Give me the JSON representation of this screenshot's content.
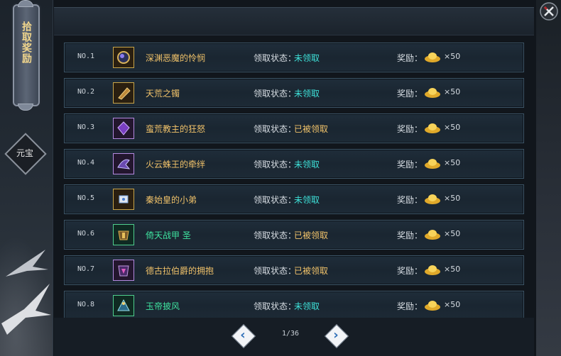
{
  "sidebar": {
    "scroll_tab_label": "拾取奖励",
    "diamond_label": "元宝"
  },
  "rows": [
    {
      "no": "NO.1",
      "icon": "dark-mask-icon",
      "name": "深渊恶魔的怜悯",
      "status_label": "领取状态：",
      "status": "未领取",
      "reward_label": "奖励：",
      "reward_icon": "gold-ingot-icon",
      "amount": "×50"
    },
    {
      "no": "NO.2",
      "icon": "bracer-icon",
      "name": "天荒之镯",
      "status_label": "领取状态：",
      "status": "未领取",
      "reward_label": "奖励：",
      "reward_icon": "gold-ingot-icon",
      "amount": "×50"
    },
    {
      "no": "NO.3",
      "icon": "purple-gem-icon",
      "name": "蛮荒教主的狂怒",
      "status_label": "领取状态：",
      "status": "已被领取",
      "reward_label": "奖励：",
      "reward_icon": "gold-ingot-icon",
      "amount": "×50"
    },
    {
      "no": "NO.4",
      "icon": "spider-blade-icon",
      "name": "火云蛛王的牵绊",
      "status_label": "领取状态：",
      "status": "未领取",
      "reward_label": "奖励：",
      "reward_icon": "gold-ingot-icon",
      "amount": "×50"
    },
    {
      "no": "NO.5",
      "icon": "trinket-icon",
      "name": "秦始皇的小弟",
      "status_label": "领取状态：",
      "status": "未领取",
      "reward_label": "奖励：",
      "reward_icon": "gold-ingot-icon",
      "amount": "×50"
    },
    {
      "no": "NO.6",
      "icon": "armor-icon",
      "name": "倚天战甲 圣",
      "status_label": "领取状态：",
      "status": "已被领取",
      "reward_label": "奖励：",
      "reward_icon": "gold-ingot-icon",
      "amount": "×50"
    },
    {
      "no": "NO.7",
      "icon": "dark-armor-icon",
      "name": "德古拉伯爵的拥抱",
      "status_label": "领取状态：",
      "status": "已被领取",
      "reward_label": "奖励：",
      "reward_icon": "gold-ingot-icon",
      "amount": "×50"
    },
    {
      "no": "NO.8",
      "icon": "cape-icon",
      "name": "玉帝披风",
      "status_label": "领取状态：",
      "status": "未领取",
      "reward_label": "奖励：",
      "reward_icon": "gold-ingot-icon",
      "amount": "×50"
    }
  ],
  "pagination": {
    "page_text": "1/36"
  },
  "colors": {
    "name_gold": "#f0c26a",
    "name_green": "#3fe3a0",
    "status_unclaimed": "#3ee0d8",
    "status_claimed": "#f0c26a",
    "close_button_red": "#b3262b"
  }
}
